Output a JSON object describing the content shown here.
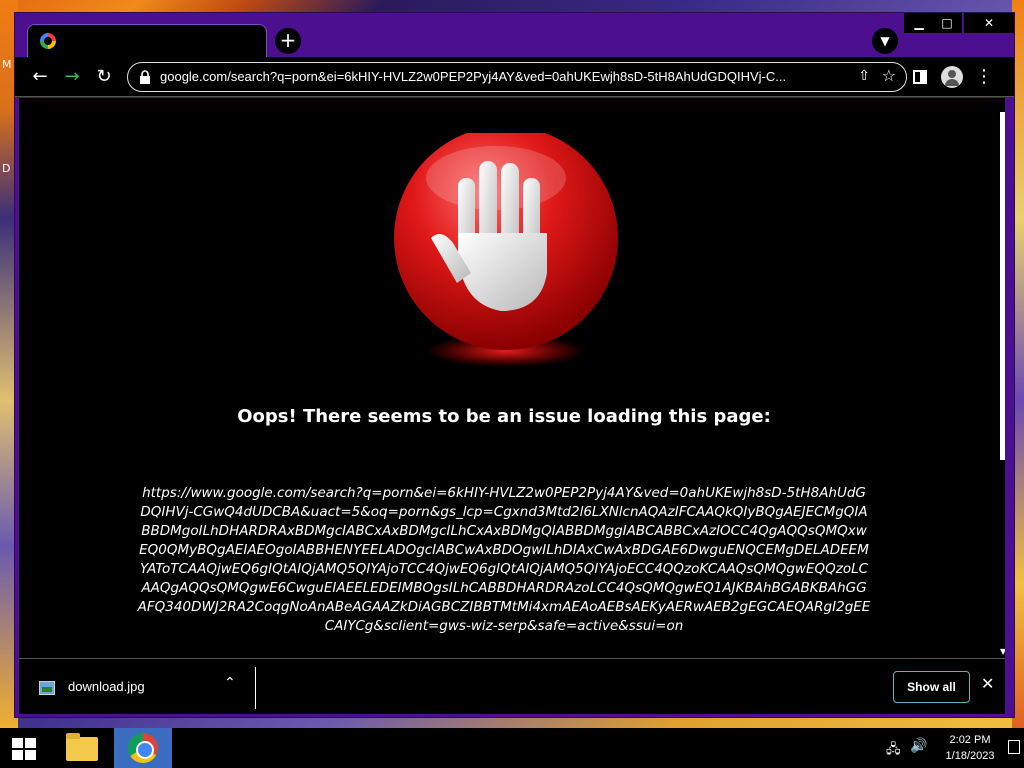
{
  "desktop": {
    "edge_letters": [
      "M",
      "D"
    ]
  },
  "browser": {
    "tab": {
      "title": "",
      "favicon": "google-g-icon"
    },
    "new_tab_label": "+",
    "window_controls": {
      "minimize": "▁",
      "maximize": "□",
      "close": "✕"
    },
    "toolbar": {
      "back": "←",
      "forward": "→",
      "reload": "↻",
      "url": "google.com/search?q=porn&ei=6kHIY-HVLZ2w0PEP2Pyj4AY&ved=0ahUKEwjh8sD-5tH8AhUdGDQIHVj-C...",
      "menu": "⋮"
    }
  },
  "page": {
    "headline": "Oops! There seems to be an issue loading this page:",
    "blocked_url": "https://www.google.com/search?q=porn&ei=6kHIY-HVLZ2w0PEP2Pyj4AY&ved=0ahUKEwjh8sD-5tH8AhUdGDQIHVj-CGwQ4dUDCBA&uact=5&oq=porn&gs_lcp=Cgxnd3Mtd2l6LXNlcnAQAzIFCAAQkQIyBQgAEJECMgQIABBDMgoILhDHARDRAxBDMgcIABCxAxBDMgcILhCxAxBDMgQIABBDMggIABCABBCxAzIOCC4QgAQQsQMQxwEQ0QMyBQgAEIAEOgoIABBHENYEELADOgcIABCwAxBDOgwILhDIAxCwAxBDGAE6DwguENQCEMgDELADEEMYAToTCAAQjwEQ6gIQtAIQjAMQ5QIYAjoTCC4QjwEQ6gIQtAIQjAMQ5QIYAjoECC4QQzoKCAAQsQMQgwEQQzoLCAAQgAQQsQMQgwE6CwguEIAEELEDEIMBOgsILhCABBDHARDRAzoLCC4QsQMQgwEQ1AJKBAhBGABKBAhGGAFQ340DWJ2RA2CoqgNoAnABeAGAAZkDiAGBCZIBBTMtMi4xmAEAoAEBsAEKyAERwAEB2gEGCAEQARgI2gEECAIYCg&sclient=gws-wiz-serp&safe=active&ssui=on"
  },
  "downloads": {
    "file_name": "download.jpg",
    "show_all": "Show all",
    "close": "✕"
  },
  "taskbar": {
    "time": "2:02 PM",
    "date": "1/18/2023"
  }
}
